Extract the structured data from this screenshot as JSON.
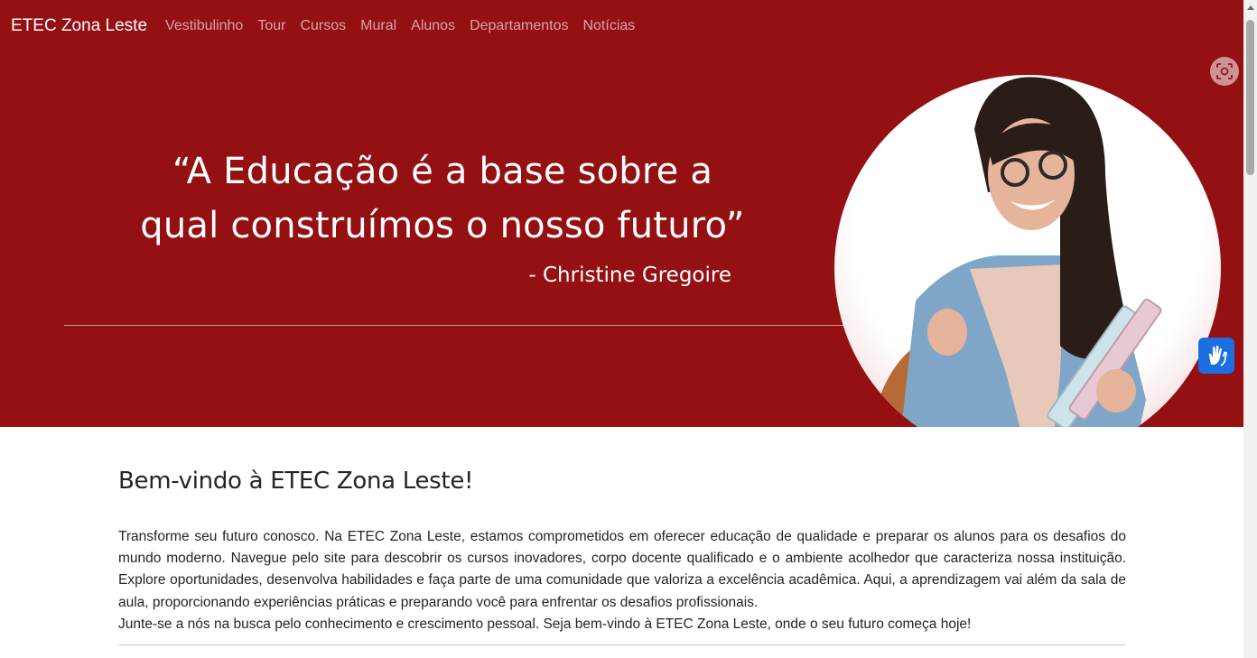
{
  "navbar": {
    "brand": "ETEC Zona Leste",
    "links": [
      "Vestibulinho",
      "Tour",
      "Cursos",
      "Mural",
      "Alunos",
      "Departamentos",
      "Notícias"
    ]
  },
  "hero": {
    "quote_line1": "“A Educação é a base sobre a",
    "quote_line2": "qual construímos o nosso futuro”",
    "author": "- Christine Gregoire",
    "background_color": "#941012",
    "image_icon": "student-photo-icon"
  },
  "main": {
    "title": "Bem-vindo à ETEC Zona Leste!",
    "paragraph1": "Transforme seu futuro conosco. Na ETEC Zona Leste, estamos comprometidos em oferecer educação de qualidade e preparar os alunos para os desafios do mundo moderno. Navegue pelo site para descobrir os cursos inovadores, corpo docente qualificado e o ambiente acolhedor que caracteriza nossa instituição. Explore oportunidades, desenvolva habilidades e faça parte de uma comunidade que valoriza a excelência acadêmica. Aqui, a aprendizagem vai além da sala de aula, proporcionando experiências práticas e preparando você para enfrentar os desafios profissionais.",
    "paragraph2": "Junte-se a nós na busca pelo conhecimento e crescimento pessoal. Seja bem-vindo à ETEC Zona Leste, onde o seu futuro começa hoje!"
  },
  "widgets": {
    "screenshot_icon": "screen-capture-icon",
    "accessibility_icon": "sign-language-hands-icon",
    "accessibility_color": "#1b6fe0"
  }
}
